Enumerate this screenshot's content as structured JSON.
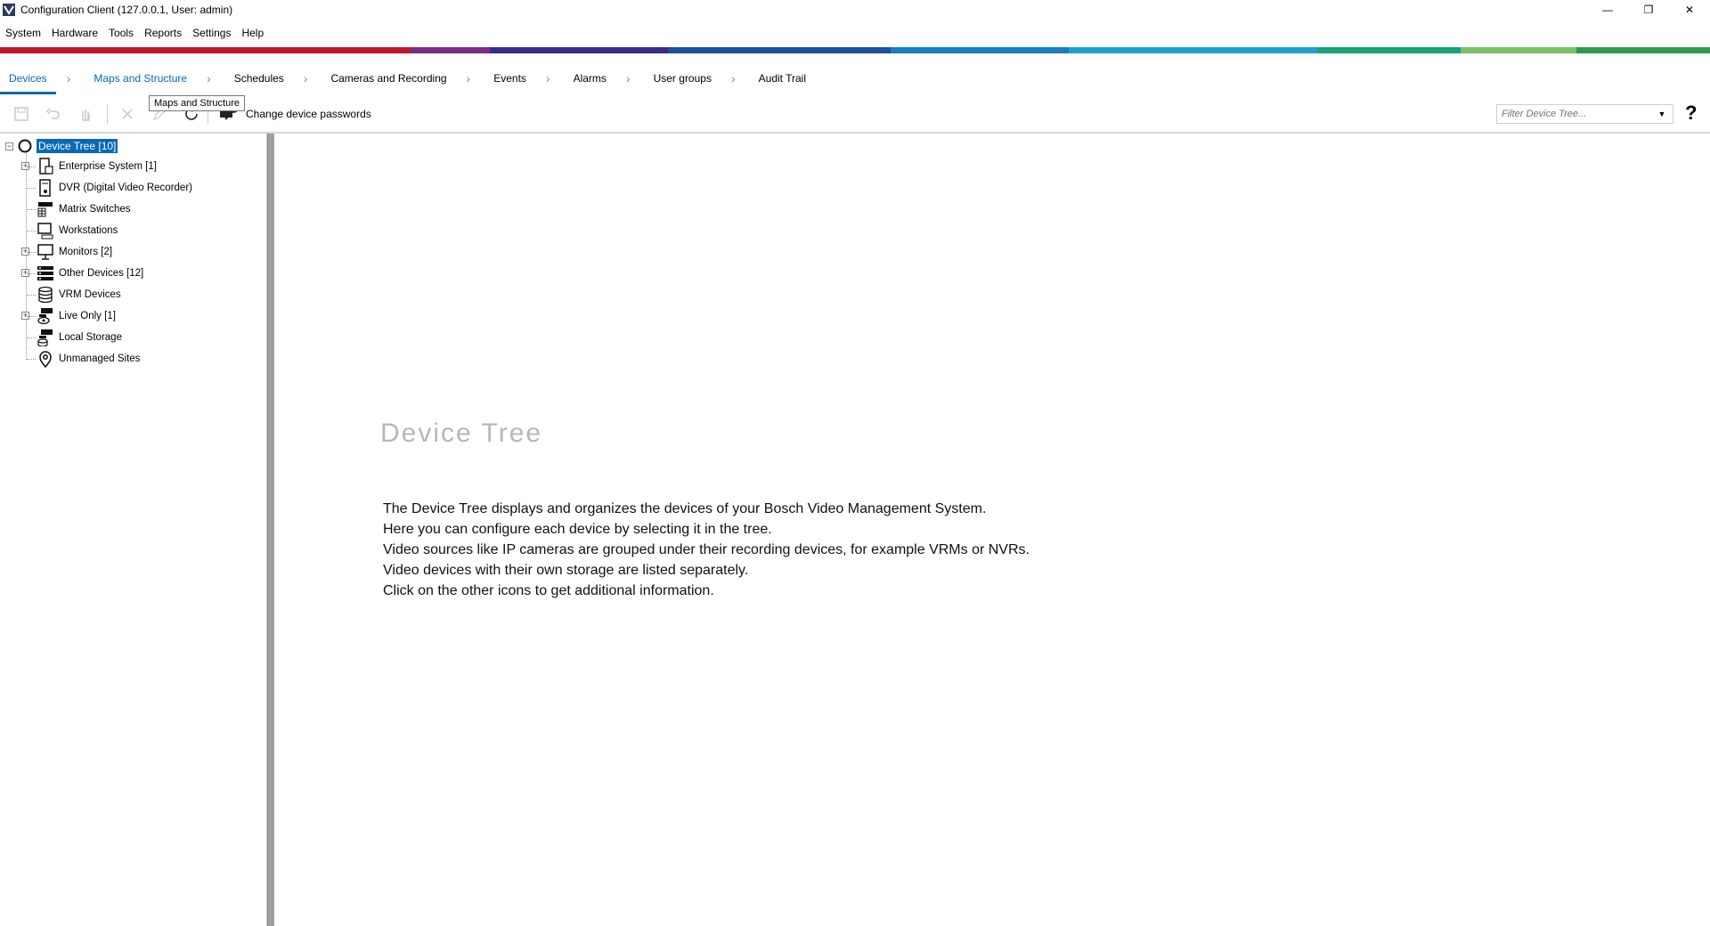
{
  "window": {
    "title": "Configuration Client (127.0.0.1, User: admin)",
    "minimize_symbol": "—",
    "restore_symbol": "❐",
    "close_symbol": "✕"
  },
  "menu": {
    "items": [
      "System",
      "Hardware",
      "Tools",
      "Reports",
      "Settings",
      "Help"
    ]
  },
  "stripe_colors": [
    "#c0162b",
    "#c0162b",
    "#7b2d83",
    "#2e3a8c",
    "#1f5fae",
    "#1e9bd4",
    "#1e9bd4",
    "#1aa374",
    "#7cc06a",
    "#2e9a52"
  ],
  "tabs": {
    "items": [
      "Devices",
      "Maps and Structure",
      "Schedules",
      "Cameras and Recording",
      "Events",
      "Alarms",
      "User groups",
      "Audit Trail"
    ],
    "active": "Devices",
    "separator": "›"
  },
  "toolbar": {
    "tooltip": "Maps and Structure",
    "change_passwords_label": "Change device passwords",
    "filter_placeholder": "Filter Device Tree...",
    "help_label": "?"
  },
  "tree": {
    "root_label": "Device Tree [10]",
    "nodes": [
      {
        "label": "Enterprise System [1]",
        "icon": "enterprise-system-icon",
        "expandable": true
      },
      {
        "label": "DVR (Digital Video Recorder)",
        "icon": "dvr-icon",
        "expandable": false
      },
      {
        "label": "Matrix Switches",
        "icon": "matrix-switch-icon",
        "expandable": false
      },
      {
        "label": "Workstations",
        "icon": "workstation-icon",
        "expandable": false
      },
      {
        "label": "Monitors [2]",
        "icon": "monitor-icon",
        "expandable": true
      },
      {
        "label": "Other Devices [12]",
        "icon": "other-devices-icon",
        "expandable": true
      },
      {
        "label": "VRM Devices",
        "icon": "vrm-devices-icon",
        "expandable": false
      },
      {
        "label": "Live Only [1]",
        "icon": "live-only-icon",
        "expandable": true
      },
      {
        "label": "Local Storage",
        "icon": "local-storage-icon",
        "expandable": false
      },
      {
        "label": "Unmanaged Sites",
        "icon": "unmanaged-sites-icon",
        "expandable": false
      }
    ]
  },
  "content": {
    "title": "Device Tree",
    "lines": [
      "The Device Tree displays and organizes the devices of your Bosch Video Management System.",
      "Here you can configure each device by selecting it in the tree.",
      "Video sources like IP cameras are grouped under their recording devices, for example VRMs or NVRs.",
      "Video devices with their own storage are listed separately.",
      "Click on the other icons to get additional information."
    ]
  }
}
